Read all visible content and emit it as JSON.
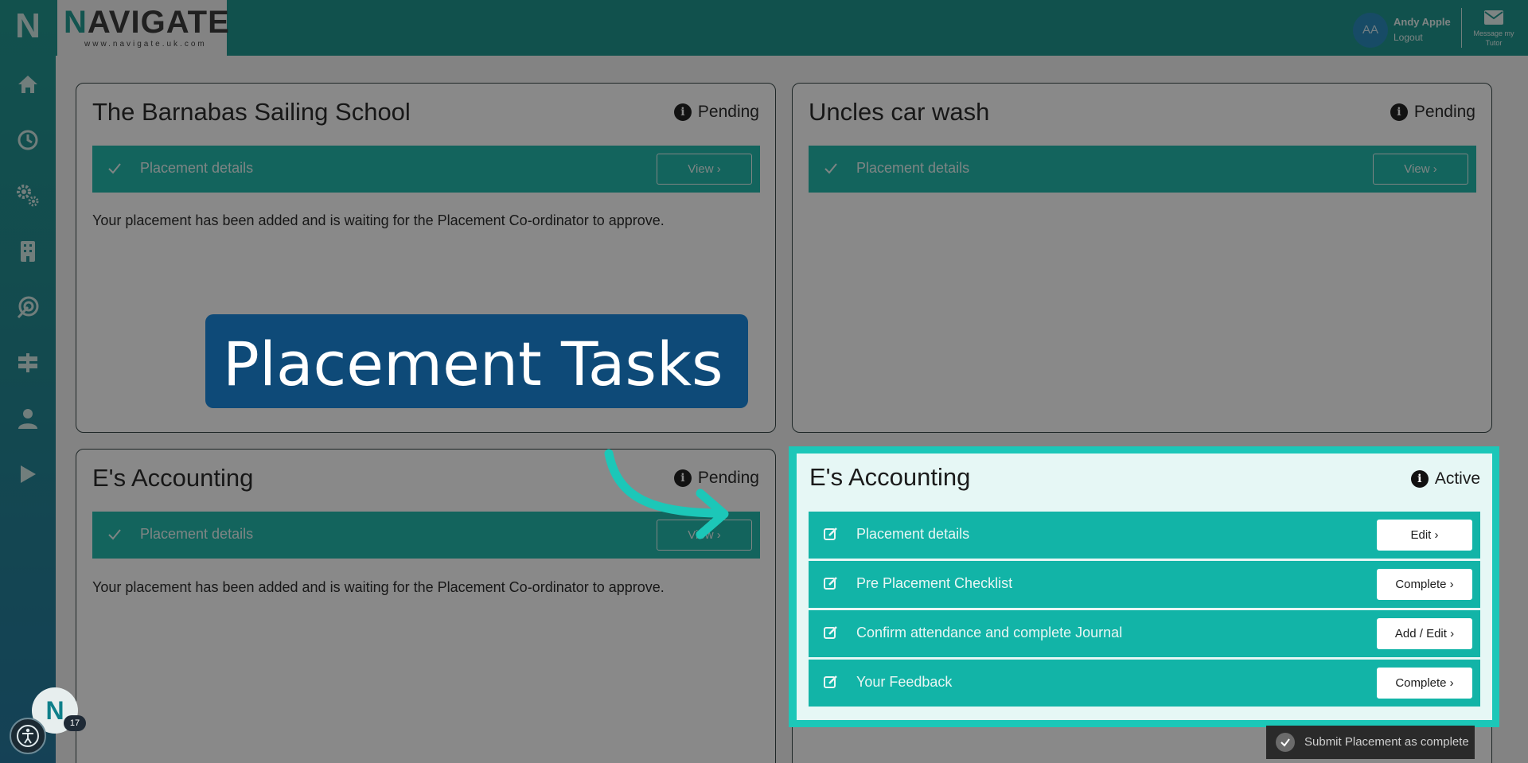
{
  "topbar": {
    "logo_letter": "N",
    "logo_rest": "AVIGATE",
    "logo_url": "www.navigate.uk.com",
    "user_initials": "AA",
    "user_name": "Andy Apple",
    "logout_label": "Logout",
    "message_label": "Message my Tutor"
  },
  "sidebar": {
    "logo": "N",
    "items": [
      {
        "icon": "home-icon"
      },
      {
        "icon": "clock-icon"
      },
      {
        "icon": "gears-icon"
      },
      {
        "icon": "building-icon"
      },
      {
        "icon": "target-icon"
      },
      {
        "icon": "signpost-icon"
      },
      {
        "icon": "user-icon"
      },
      {
        "icon": "play-icon"
      }
    ],
    "fab_letter": "N",
    "fab_badge": "17"
  },
  "cards": [
    {
      "title": "The Barnabas Sailing School",
      "status": "Pending",
      "tasks": [
        {
          "label": "Placement details",
          "button": "View ›"
        }
      ],
      "note": "Your placement has been added and is waiting for the Placement Co-ordinator to approve."
    },
    {
      "title": "Uncles car wash",
      "status": "Pending",
      "tasks": [
        {
          "label": "Placement details",
          "button": "View ›"
        }
      ],
      "note": ""
    },
    {
      "title": "E's Accounting",
      "status": "Pending",
      "tasks": [
        {
          "label": "Placement details",
          "button": "View ›"
        }
      ],
      "note": "Your placement has been added and is waiting for the Placement Co-ordinator to approve."
    }
  ],
  "active_card": {
    "title": "E's Accounting",
    "status": "Active",
    "tasks": [
      {
        "label": "Placement details",
        "button": "Edit ›"
      },
      {
        "label": "Pre Placement Checklist",
        "button": "Complete ›"
      },
      {
        "label": "Confirm attendance and complete Journal",
        "button": "Add / Edit ›"
      },
      {
        "label": "Your Feedback",
        "button": "Complete ›"
      }
    ],
    "submit_label": "Submit Placement as complete"
  },
  "callout": {
    "text": "Placement Tasks"
  },
  "colors": {
    "teal": "#12b4a7",
    "topbar": "#0f8f86",
    "callout": "#0e4a78",
    "highlight": "#1cc7b8"
  }
}
